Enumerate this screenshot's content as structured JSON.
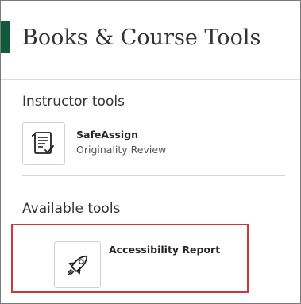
{
  "header": {
    "title": "Books & Course Tools"
  },
  "sections": {
    "instructor": {
      "heading": "Instructor tools",
      "tools": [
        {
          "name": "SafeAssign",
          "description": "Originality Review",
          "icon": "document-check-icon"
        }
      ]
    },
    "available": {
      "heading": "Available tools",
      "tools": [
        {
          "name": "Accessibility Report",
          "icon": "rocket-icon"
        }
      ]
    }
  },
  "colors": {
    "accent": "#0f5a3a",
    "highlight": "#c6393c",
    "text": "#333333",
    "divider": "#d6d6d6"
  }
}
